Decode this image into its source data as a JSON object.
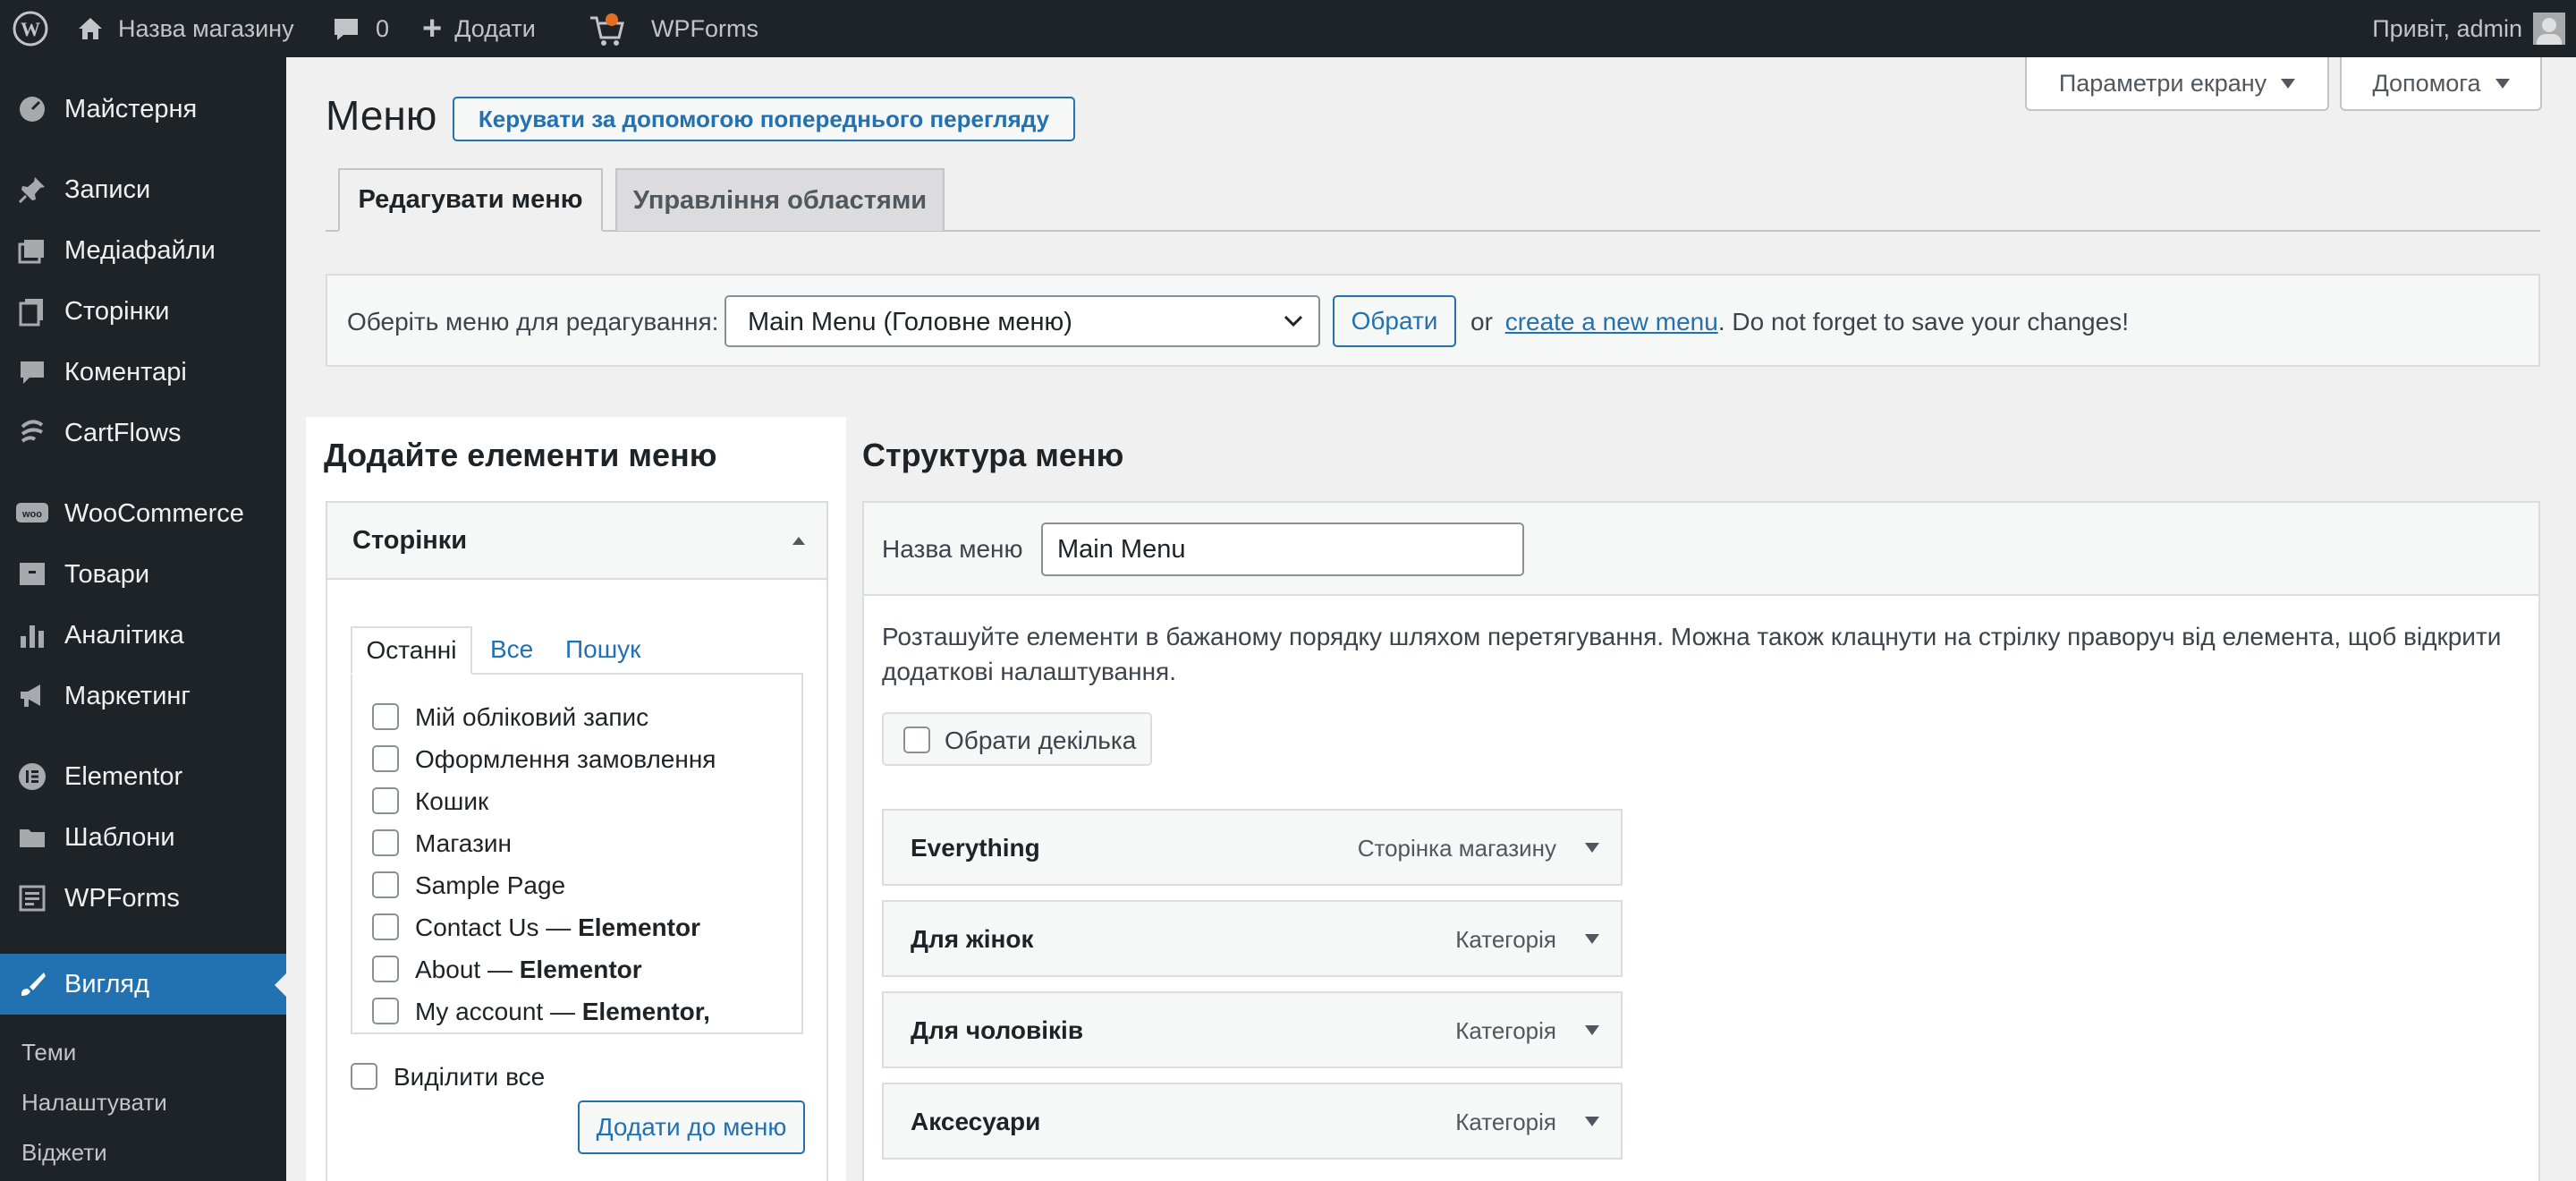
{
  "adminbar": {
    "site_name": "Назва магазину",
    "comments_count": "0",
    "new_label": "Додати",
    "wpforms": "WPForms",
    "greeting": "Привіт, admin"
  },
  "sidebar": {
    "items": [
      {
        "label": "Майстерня",
        "icon": "dashboard-icon"
      },
      {
        "label": "Записи",
        "icon": "pin-icon"
      },
      {
        "label": "Медіафайли",
        "icon": "media-icon"
      },
      {
        "label": "Сторінки",
        "icon": "pages-icon"
      },
      {
        "label": "Коментарі",
        "icon": "comments-icon"
      },
      {
        "label": "CartFlows",
        "icon": "cartflows-icon"
      },
      {
        "label": "WooCommerce",
        "icon": "woocommerce-icon"
      },
      {
        "label": "Товари",
        "icon": "products-icon"
      },
      {
        "label": "Аналітика",
        "icon": "analytics-icon"
      },
      {
        "label": "Маркетинг",
        "icon": "megaphone-icon"
      },
      {
        "label": "Elementor",
        "icon": "elementor-icon"
      },
      {
        "label": "Шаблони",
        "icon": "folder-icon"
      },
      {
        "label": "WPForms",
        "icon": "wpforms-icon"
      },
      {
        "label": "Вигляд",
        "icon": "brush-icon",
        "active": true
      }
    ],
    "submenu": [
      "Теми",
      "Налаштувати",
      "Віджети"
    ]
  },
  "header": {
    "screen_options": "Параметри екрану",
    "help": "Допомога",
    "title": "Меню",
    "preview_button": "Керувати за допомогою попереднього перегляду"
  },
  "tabs": [
    "Редагувати меню",
    "Управління областями"
  ],
  "select_bar": {
    "label": "Оберіть меню для редагування:",
    "selected": "Main Menu (Головне меню)",
    "choose_button": "Обрати",
    "or": "or",
    "create_link": "create a new menu",
    "note": ". Do not forget to save your changes!"
  },
  "add_items": {
    "heading": "Додайте елементи меню",
    "section_title": "Сторінки",
    "inner_tabs": [
      "Останні",
      "Все",
      "Пошук"
    ],
    "pages": [
      {
        "title": "Мій обліковий запис",
        "suffix": ""
      },
      {
        "title": "Оформлення замовлення",
        "suffix": ""
      },
      {
        "title": "Кошик",
        "suffix": ""
      },
      {
        "title": "Магазин",
        "suffix": ""
      },
      {
        "title": "Sample Page",
        "suffix": ""
      },
      {
        "title": "Contact Us — ",
        "suffix": "Elementor"
      },
      {
        "title": "About — ",
        "suffix": "Elementor"
      },
      {
        "title": "My account — ",
        "suffix": "Elementor,"
      }
    ],
    "select_all": "Виділити все",
    "add_button": "Додати до меню"
  },
  "structure": {
    "heading": "Структура меню",
    "name_label": "Назва меню",
    "name_value": "Main Menu",
    "instructions": "Розташуйте елементи в бажаному порядку шляхом перетягування. Можна також клацнути на стрілку праворуч від елемента, щоб відкрити додаткові налаштування.",
    "bulk_select": "Обрати декілька",
    "items": [
      {
        "title": "Everything",
        "type": "Сторінка магазину"
      },
      {
        "title": "Для жінок",
        "type": "Категорія"
      },
      {
        "title": "Для чоловіків",
        "type": "Категорія"
      },
      {
        "title": "Аксесуари",
        "type": "Категорія"
      }
    ]
  },
  "colors": {
    "adminbar": "#1d2327",
    "accent": "#2271b1",
    "background": "#f0f0f1"
  }
}
